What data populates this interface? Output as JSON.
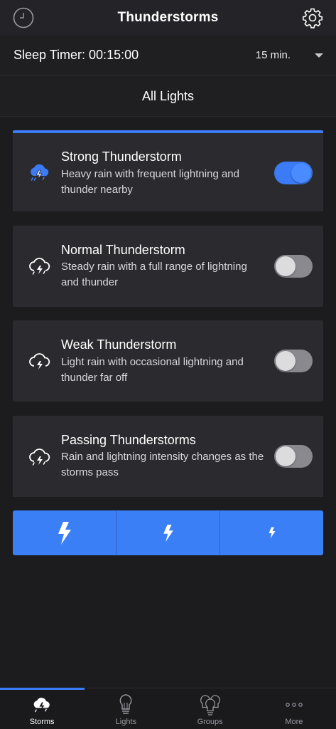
{
  "header": {
    "title": "Thunderstorms",
    "left_icon": "clock-icon",
    "right_icon": "gear-icon"
  },
  "sleep_timer": {
    "label": "Sleep Timer: 00:15:00",
    "selected": "15 min."
  },
  "all_lights": {
    "label": "All Lights"
  },
  "storms": [
    {
      "name": "Strong Thunderstorm",
      "description": "Heavy rain with frequent lightning and thunder nearby",
      "icon": "storm-cloud-icon",
      "enabled": true
    },
    {
      "name": "Normal Thunderstorm",
      "description": "Steady rain with a full range of lightning and thunder",
      "icon": "storm-cloud-icon",
      "enabled": false
    },
    {
      "name": "Weak Thunderstorm",
      "description": "Light rain with occasional lightning and thunder far off",
      "icon": "storm-cloud-icon",
      "enabled": false
    },
    {
      "name": "Passing Thunderstorms",
      "description": "Rain and lightning intensity changes as the storms pass",
      "icon": "storm-cloud-icon",
      "enabled": false
    }
  ],
  "intensity_buttons": [
    {
      "icon": "lightning-large-icon"
    },
    {
      "icon": "lightning-medium-icon"
    },
    {
      "icon": "lightning-small-icon"
    }
  ],
  "tabs": [
    {
      "label": "Storms",
      "icon": "storm-cloud-icon",
      "active": true
    },
    {
      "label": "Lights",
      "icon": "lightbulb-icon",
      "active": false
    },
    {
      "label": "Groups",
      "icon": "lightbulb-group-icon",
      "active": false
    },
    {
      "label": "More",
      "icon": "more-dots-icon",
      "active": false
    }
  ],
  "colors": {
    "accent": "#3b7bf6",
    "background": "#1c1c1f",
    "card": "#2b2b2f"
  }
}
